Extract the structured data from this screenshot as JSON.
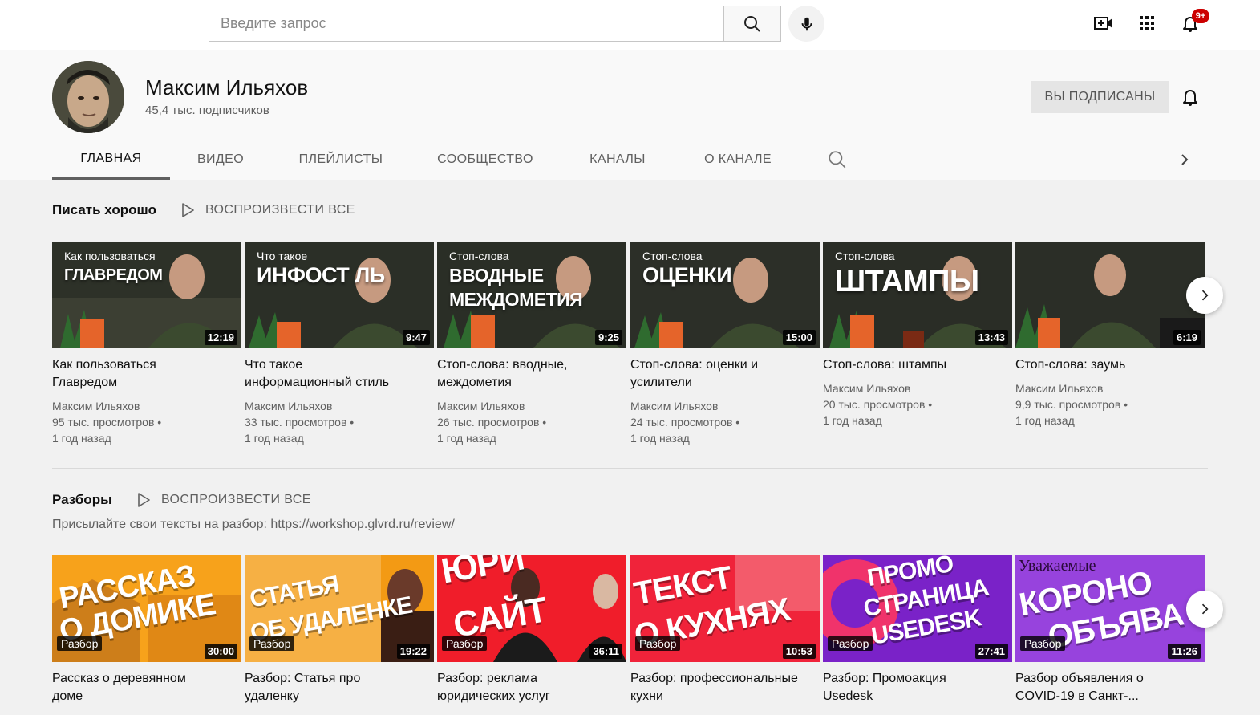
{
  "search": {
    "placeholder": "Введите запрос"
  },
  "header": {
    "notifications_badge": "9+"
  },
  "channel": {
    "name": "Максим Ильяхов",
    "subscribers": "45,4 тыс. подписчиков",
    "subscribe_label": "ВЫ ПОДПИСАНЫ"
  },
  "tabs": [
    {
      "label": "ГЛАВНАЯ"
    },
    {
      "label": "ВИДЕО"
    },
    {
      "label": "ПЛЕЙЛИСТЫ"
    },
    {
      "label": "СООБЩЕСТВО"
    },
    {
      "label": "КАНАЛЫ"
    },
    {
      "label": "О КАНАЛЕ"
    }
  ],
  "shelves": [
    {
      "title": "Писать хорошо",
      "play_all": "ВОСПРОИЗВЕСТИ ВСЕ",
      "videos": [
        {
          "title_l1": "Как пользоваться",
          "title_l2": "Главредом",
          "channel": "Максим Ильяхов",
          "views": "95 тыс. просмотров •",
          "age": "1 год назад",
          "duration": "12:19",
          "thumb_top": "Как пользоваться",
          "thumb_big": "ГЛАВРЕДОМ"
        },
        {
          "title_l1": "Что такое",
          "title_l2": "информационный стиль",
          "channel": "Максим Ильяхов",
          "views": "33 тыс. просмотров •",
          "age": "1 год назад",
          "duration": "9:47",
          "thumb_top": "Что такое",
          "thumb_big": "ИНФОСТ   ЛЬ"
        },
        {
          "title_l1": "Стоп-слова: вводные,",
          "title_l2": "междометия",
          "channel": "Максим Ильяхов",
          "views": "26 тыс. просмотров •",
          "age": "1 год назад",
          "duration": "9:25",
          "thumb_top": "Стоп-слова",
          "thumb_big": "ВВОДНЫЕ",
          "thumb_big2": "МЕЖДОМЕТИЯ"
        },
        {
          "title_l1": "Стоп-слова: оценки и",
          "title_l2": "усилители",
          "channel": "Максим Ильяхов",
          "views": "24 тыс. просмотров •",
          "age": "1 год назад",
          "duration": "15:00",
          "thumb_top": "Стоп-слова",
          "thumb_big": "ОЦЕНКИ"
        },
        {
          "title_l1": "Стоп-слова: штампы",
          "channel": "Максим Ильяхов",
          "views": "20 тыс. просмотров •",
          "age": "1 год назад",
          "duration": "13:43",
          "thumb_top": "Стоп-слова",
          "thumb_big": "ШТАМПЫ"
        },
        {
          "title_l1": "Стоп-слова: заумь",
          "channel": "Максим Ильяхов",
          "views": "9,9 тыс. просмотров •",
          "age": "1 год назад",
          "duration": "6:19"
        }
      ]
    },
    {
      "title": "Разборы",
      "play_all": "ВОСПРОИЗВЕСТИ ВСЕ",
      "description": "Присылайте свои тексты на разбор: https://workshop.glvrd.ru/review/",
      "videos": [
        {
          "title_l1": "Рассказ о деревянном",
          "title_l2": "доме",
          "tag": "Разбор",
          "duration": "30:00",
          "art_l1": "РАССКАЗ",
          "art_l2": "О ДОМИКЕ",
          "color": "#f7a21b"
        },
        {
          "title_l1": "Разбор: Статья про",
          "title_l2": "удаленку",
          "tag": "Разбор",
          "duration": "19:22",
          "art_l1": "СТАТЬЯ",
          "art_l2": "ОБ УДАЛЕНКЕ",
          "color": "#f39a14"
        },
        {
          "title_l1": "Разбор: реклама",
          "title_l2": "юридических услуг",
          "tag": "Разбор",
          "duration": "36:11",
          "art_l1": "ЮРИ",
          "art_l2": "САЙТ",
          "color": "#f01d2a"
        },
        {
          "title_l1": "Разбор: профессиональные",
          "title_l2": "кухни",
          "tag": "Разбор",
          "duration": "10:53",
          "art_l1": "ТЕКСТ",
          "art_l2": "О КУХНЯХ",
          "color": "#f0233a"
        },
        {
          "title_l1": "Разбор: Промоакция",
          "title_l2": "Usedesk",
          "tag": "Разбор",
          "duration": "27:41",
          "art_l1": "ПРОМО",
          "art_l2": "СТРАНИЦА",
          "art_l3": "USEDESK",
          "color": "#c0208f"
        },
        {
          "title_l1": "Разбор объявления о",
          "title_l2": "COVID-19 в Санкт-...",
          "tag": "Разбор",
          "duration": "11:26",
          "art_l1": "КОРОНО",
          "art_l2": "ОБЪЯВА",
          "art_top": "Уважаемые",
          "color": "#8a2bd8"
        }
      ]
    }
  ],
  "colors": {
    "accent_red": "#cc0000",
    "background": "#f1f1f1"
  }
}
